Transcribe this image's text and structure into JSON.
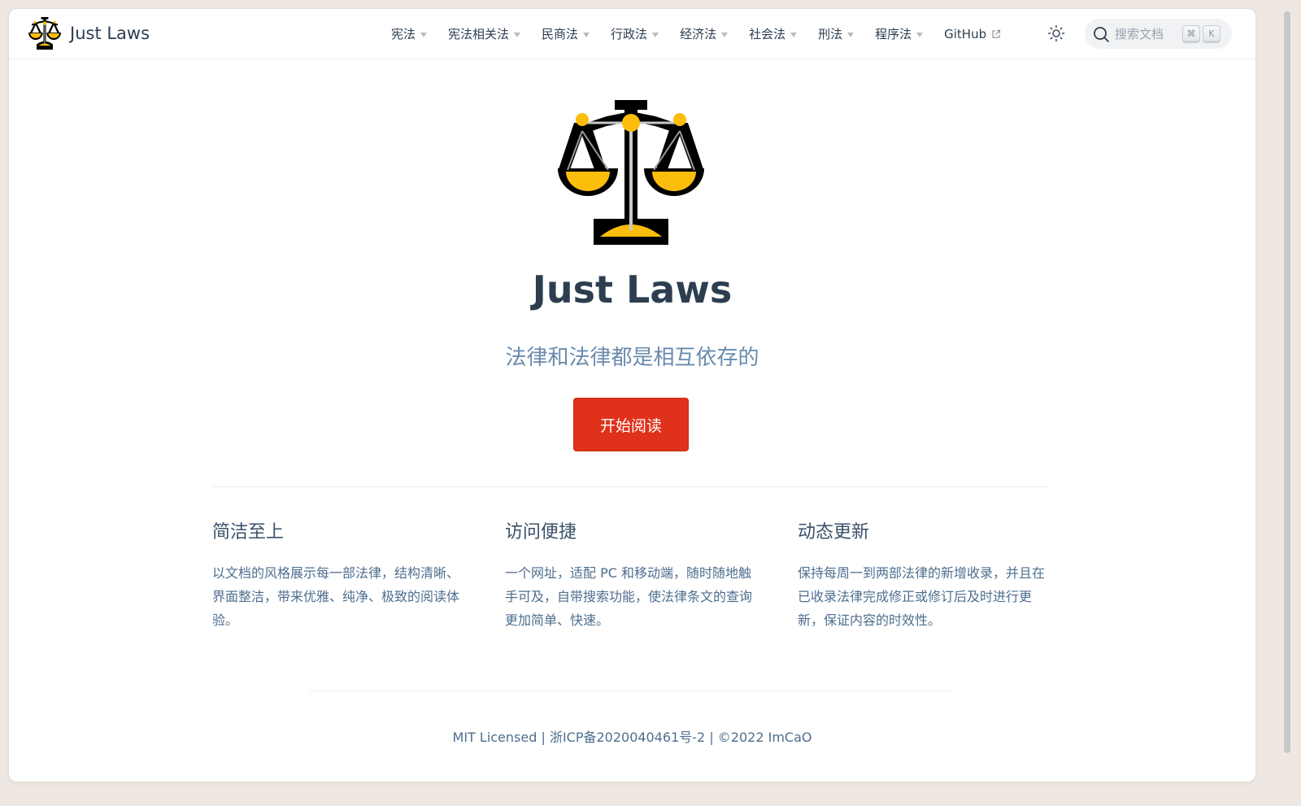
{
  "site": {
    "brand_name": "Just Laws"
  },
  "nav": {
    "items": [
      {
        "label": "宪法",
        "dropdown": true
      },
      {
        "label": "宪法相关法",
        "dropdown": true
      },
      {
        "label": "民商法",
        "dropdown": true
      },
      {
        "label": "行政法",
        "dropdown": true
      },
      {
        "label": "经济法",
        "dropdown": true
      },
      {
        "label": "社会法",
        "dropdown": true
      },
      {
        "label": "刑法",
        "dropdown": true
      },
      {
        "label": "程序法",
        "dropdown": true
      }
    ],
    "github_label": "GitHub",
    "theme_icon": "sun-icon",
    "search": {
      "placeholder": "搜索文档",
      "key1": "⌘",
      "key2": "K"
    }
  },
  "hero": {
    "title": "Just Laws",
    "tagline": "法律和法律都是相互依存的",
    "cta_label": "开始阅读",
    "logo_icon": "balance-scale-icon"
  },
  "features": [
    {
      "title": "简洁至上",
      "text": "以文档的风格展示每一部法律，结构清晰、界面整洁，带来优雅、纯净、极致的阅读体验。"
    },
    {
      "title": "访问便捷",
      "text": "一个网址，适配 PC 和移动端，随时随地触手可及，自带搜索功能，使法律条文的查询更加简单、快速。"
    },
    {
      "title": "动态更新",
      "text": "保持每周一到两部法律的新增收录，并且在已收录法律完成修正或修订后及时进行更新，保证内容的时效性。"
    }
  ],
  "footer": {
    "text": "MIT Licensed | 浙ICP备2020040461号-2 | ©2022 ImCaO"
  },
  "colors": {
    "accent": "#e0311a",
    "text": "#2c3e50",
    "muted": "#6a8bad",
    "scale_gold": "#fcbe0a"
  }
}
